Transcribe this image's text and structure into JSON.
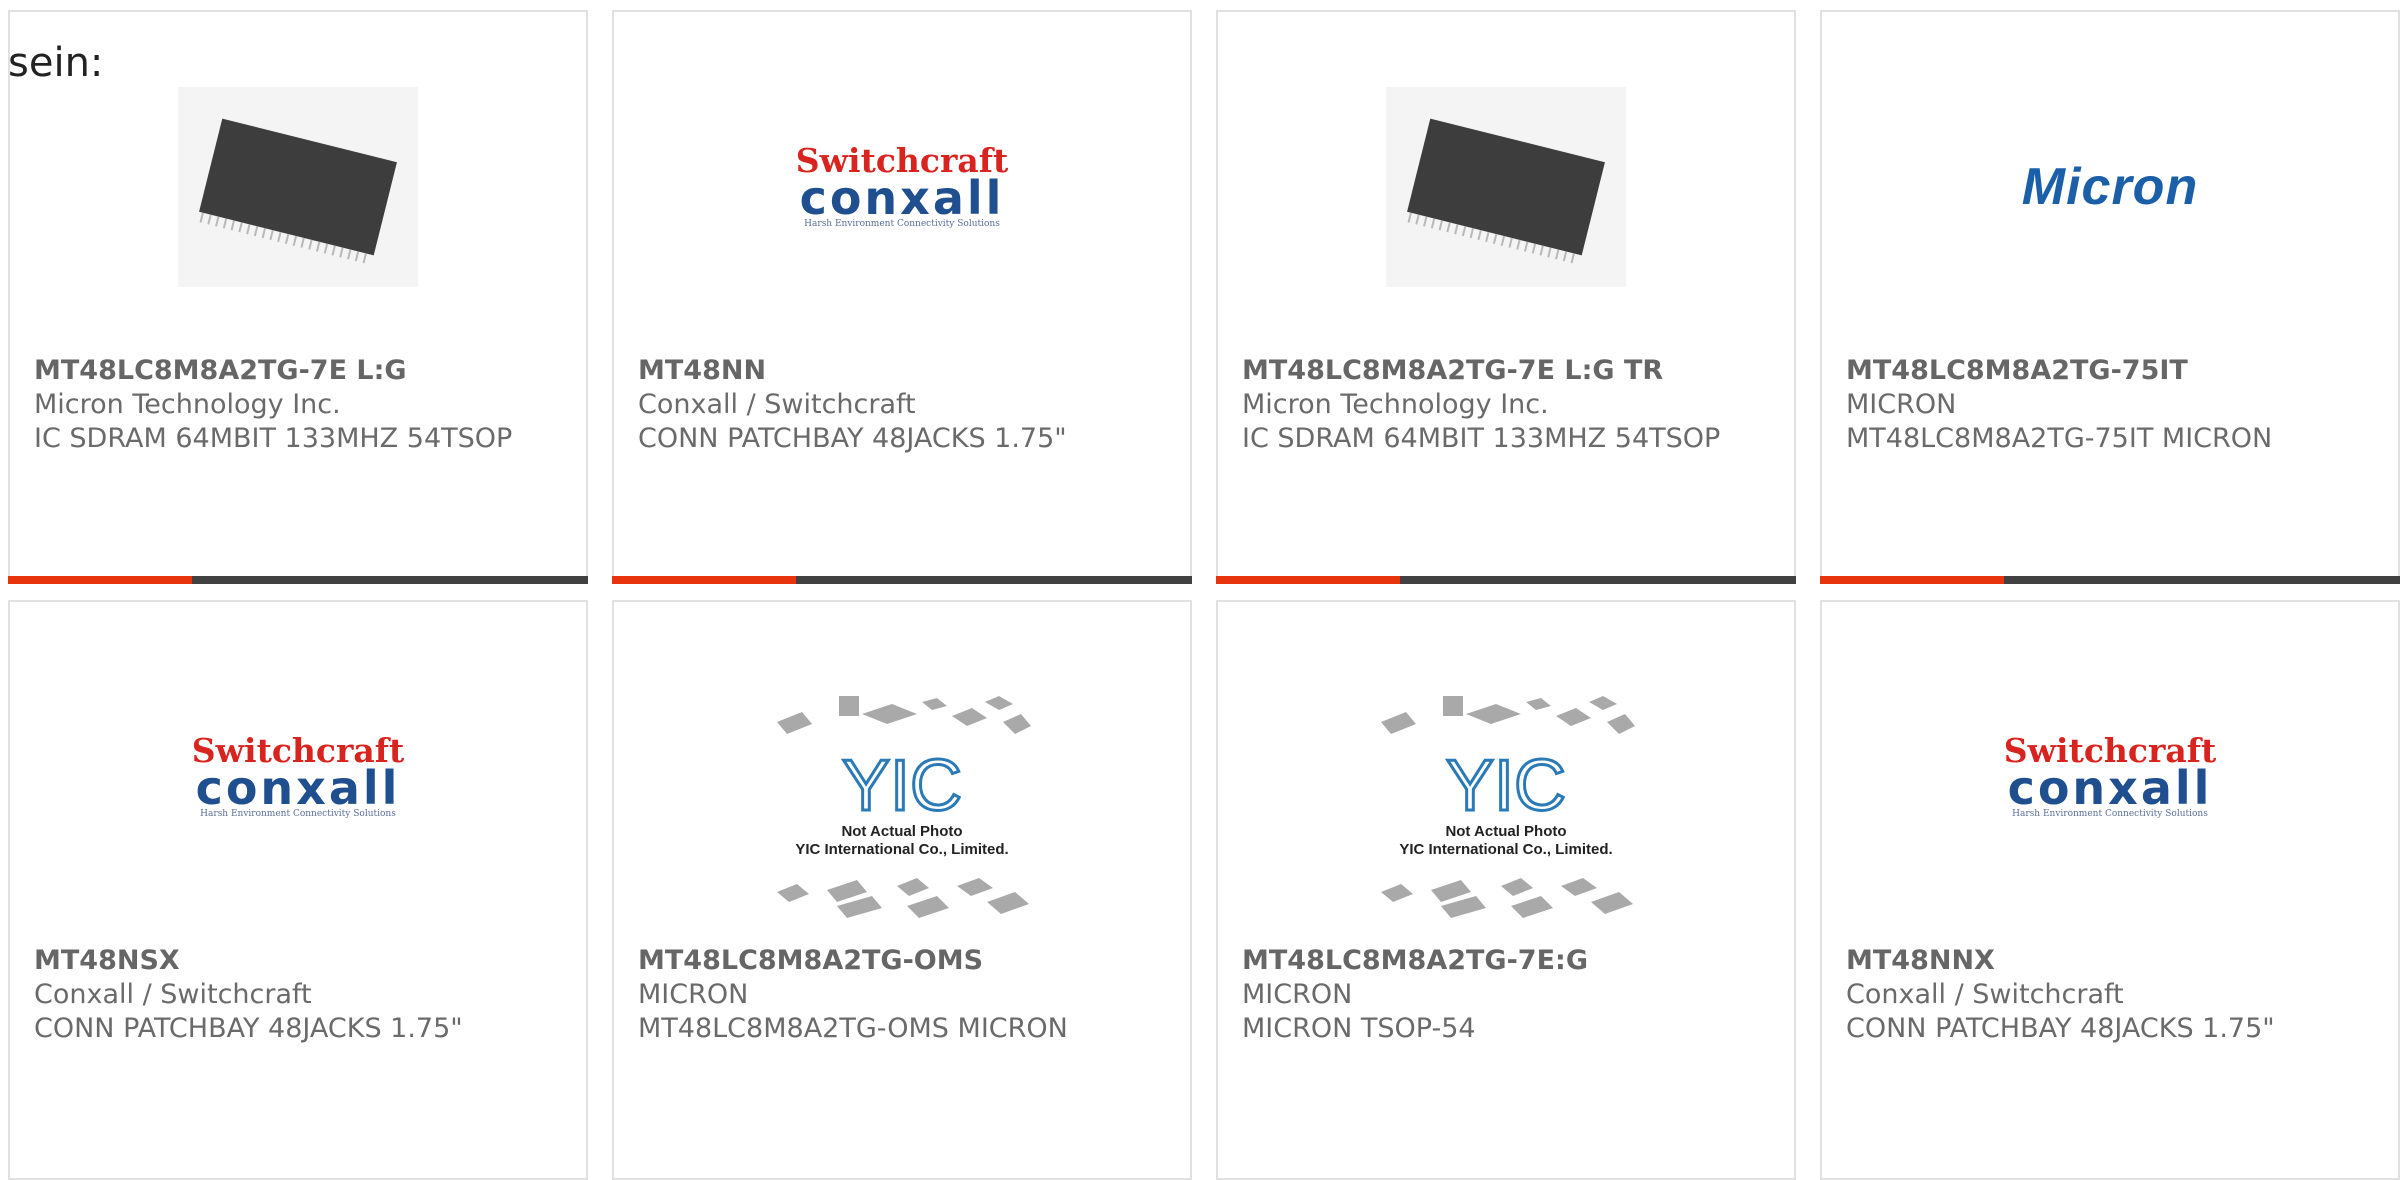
{
  "lead_text": "sein:",
  "colors": {
    "accent_red": "#e8340c",
    "bar_dark": "#414141",
    "border": "#e1e1e1"
  },
  "cards": [
    {
      "part": "MT48LC8M8A2TG-7E L:G",
      "maker": "Micron Technology Inc.",
      "desc": "IC SDRAM 64MBIT 133MHZ 54TSOP",
      "image": "tsop-chip-photo"
    },
    {
      "part": "MT48NN",
      "maker": "Conxall / Switchcraft",
      "desc": "CONN PATCHBAY 48JACKS 1.75\"",
      "image": "switchcraft-conxall-logo"
    },
    {
      "part": "MT48LC8M8A2TG-7E L:G TR",
      "maker": "Micron Technology Inc.",
      "desc": "IC SDRAM 64MBIT 133MHZ 54TSOP",
      "image": "tsop-chip-photo"
    },
    {
      "part": "MT48LC8M8A2TG-75IT",
      "maker": "MICRON",
      "desc": "MT48LC8M8A2TG-75IT MICRON",
      "image": "micron-logo"
    },
    {
      "part": "MT48NSX",
      "maker": "Conxall / Switchcraft",
      "desc": "CONN PATCHBAY 48JACKS 1.75\"",
      "image": "switchcraft-conxall-logo"
    },
    {
      "part": "MT48LC8M8A2TG-OMS",
      "maker": "MICRON",
      "desc": "MT48LC8M8A2TG-OMS MICRON",
      "image": "yic-placeholder"
    },
    {
      "part": "MT48LC8M8A2TG-7E:G",
      "maker": "MICRON",
      "desc": "MICRON TSOP-54",
      "image": "yic-placeholder"
    },
    {
      "part": "MT48NNX",
      "maker": "Conxall / Switchcraft",
      "desc": "CONN PATCHBAY 48JACKS 1.75\"",
      "image": "switchcraft-conxall-logo"
    }
  ],
  "logos": {
    "switchcraft": "Switchcraft",
    "conxall": "conxall",
    "switchcraft_tagline": "Harsh Environment Connectivity Solutions",
    "micron": "Micron",
    "yic_mark": "YIC",
    "yic_line1": "Not Actual Photo",
    "yic_line2": "YIC International Co., Limited."
  }
}
